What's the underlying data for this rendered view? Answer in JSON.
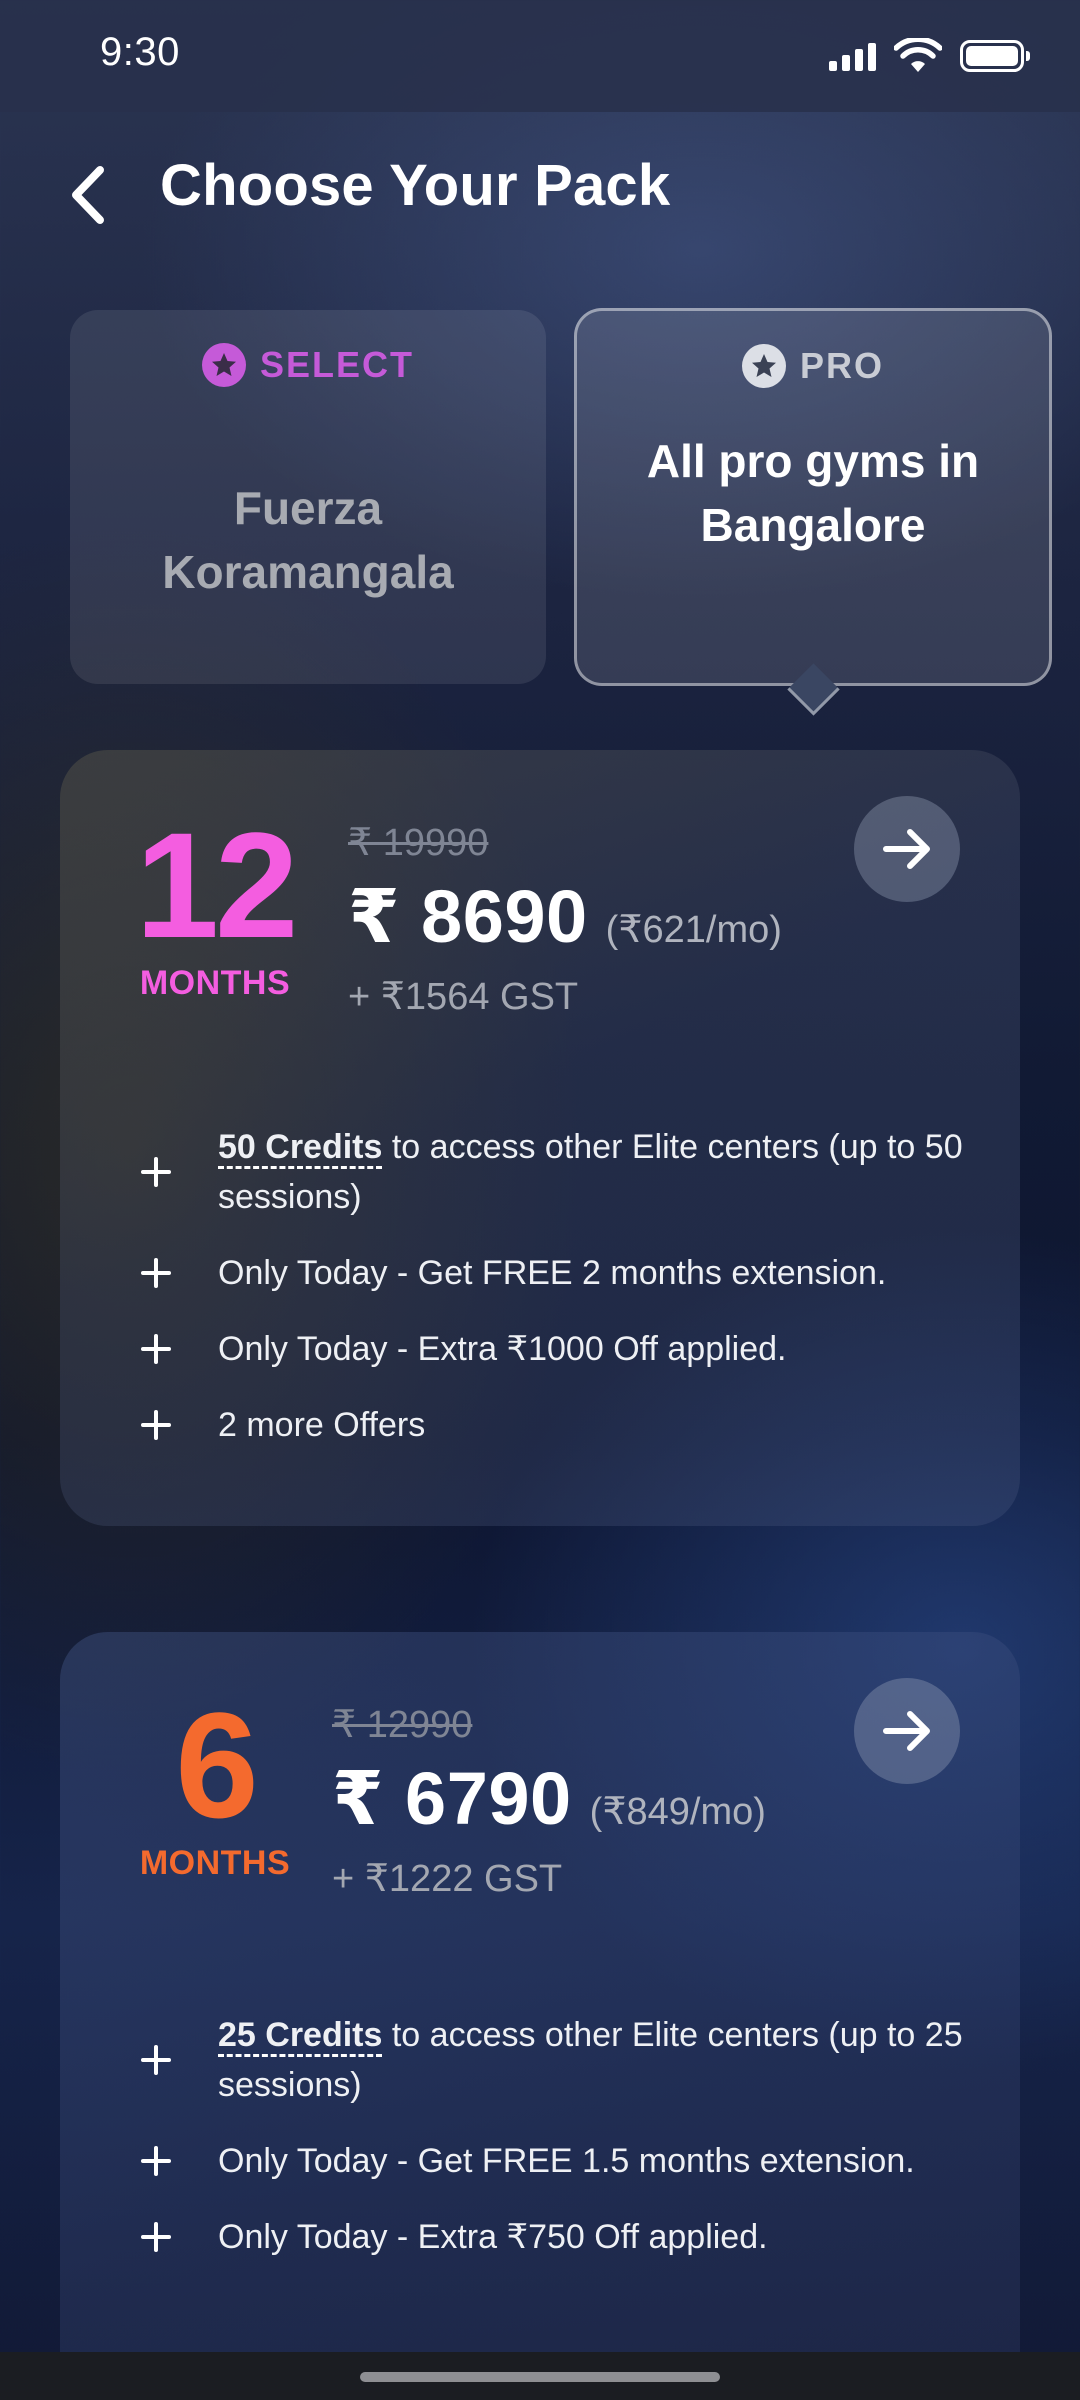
{
  "status_bar": {
    "time": "9:30"
  },
  "header": {
    "title": "Choose Your Pack",
    "back_icon": "chevron-left-icon"
  },
  "tiers": [
    {
      "name": "SELECT",
      "description": "Fuerza Koramangala",
      "color": "#c55ad8",
      "selected": false
    },
    {
      "name": "PRO",
      "description": "All pro gyms in Bangalore",
      "color": "#dcdfe6",
      "selected": true
    }
  ],
  "packs": [
    {
      "duration": "12",
      "unit": "MONTHS",
      "color": "#f45de0",
      "old_price": "₹ 19990",
      "price": "₹ 8690",
      "per_month": "(₹621/mo)",
      "gst": "+ ₹1564 GST",
      "offers": [
        {
          "credits": "50 Credits",
          "text": " to access other Elite centers (up to 50 sessions)"
        },
        {
          "text": "Only Today - Get FREE 2 months extension."
        },
        {
          "text": "Only Today - Extra ₹1000 Off applied."
        },
        {
          "text": "2 more Offers"
        }
      ]
    },
    {
      "duration": "6",
      "unit": "MONTHS",
      "color": "#f46a2e",
      "old_price": "₹ 12990",
      "price": "₹ 6790",
      "per_month": "(₹849/mo)",
      "gst": "+ ₹1222 GST",
      "offers": [
        {
          "credits": "25 Credits",
          "text": " to access other Elite centers (up to 25 sessions)"
        },
        {
          "text": "Only Today - Get FREE 1.5 months extension."
        },
        {
          "text": "Only Today - Extra ₹750 Off applied."
        }
      ]
    }
  ]
}
